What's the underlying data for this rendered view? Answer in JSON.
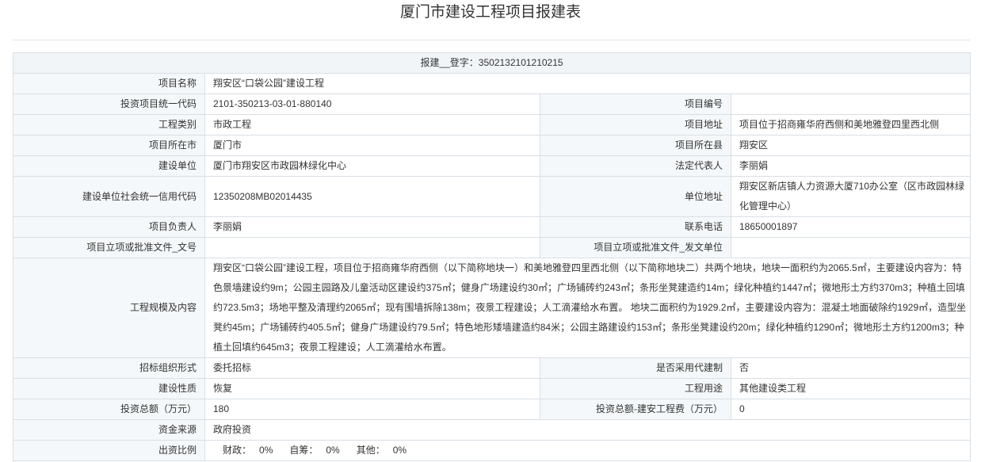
{
  "title": "厦门市建设工程项目报建表",
  "registration": {
    "label": "报建__登字：",
    "number": "3502132101210215"
  },
  "form": {
    "project_name": {
      "label": "项目名称",
      "value": "翔安区“口袋公园”建设工程"
    },
    "investment_code": {
      "label": "投资项目统一代码",
      "value": "2101-350213-03-01-880140"
    },
    "project_number": {
      "label": "项目编号"
    },
    "project_category": {
      "label": "工程类别",
      "value": "市政工程"
    },
    "project_address": {
      "label": "项目地址",
      "value": "项目位于招商雍华府西侧和美地雅登四里西北侧"
    },
    "project_city": {
      "label": "项目所在市",
      "value": "厦门市"
    },
    "project_county": {
      "label": "项目所在县",
      "value": "翔安区"
    },
    "construction_unit": {
      "label": "建设单位",
      "value": "厦门市翔安区市政园林绿化中心"
    },
    "legal_representative": {
      "label": "法定代表人",
      "value": "李丽娟"
    },
    "credit_code": {
      "label": "建设单位社会统一信用代码",
      "value": "12350208MB02014435"
    },
    "unit_address": {
      "label": "单位地址",
      "value": "翔安区新店镇人力资源大厦710办公室（区市政园林绿化管理中心）"
    },
    "project_leader": {
      "label": "项目负责人",
      "value": "李丽娟"
    },
    "contact_phone": {
      "label": "联系电话",
      "value": "18650001897"
    },
    "approval_doc_number": {
      "label": "项目立项或批准文件_文号"
    },
    "approval_issuing_unit": {
      "label": "项目立项或批准文件_发文单位"
    },
    "scale_and_content": {
      "label": "工程规模及内容",
      "value": "翔安区“口袋公园”建设工程，项目位于招商雍华府西侧（以下简称地块一）和美地雅登四里西北侧（以下简称地块二）共两个地块，地块一面积约为2065.5㎡，主要建设内容为：特色景墙建设约9m；公园主园路及儿童活动区建设约375㎡；健身广场建设约30㎡；广场铺砖约243㎡；条形坐凳建造约14m；绿化种植约1447㎡；微地形土方约370m3；种植土回填约723.5m3；场地平整及清理约2065㎡；现有围墙拆除138m；夜景工程建设；人工滴灌给水布置。 地块二面积约为1929.2㎡，主要建设内容为：混凝土地面破除约1929㎡，造型坐凳约45m；广场铺砖约405.5㎡；健身广场建设约79.5㎡；特色地形矮墙建造约84米；公园主路建设约153㎡；条形坐凳建设约20m；绿化种植约1290㎡；微地形土方约1200m3；种植土回填约645m3；夜景工程建设；人工滴灌给水布置。"
    },
    "tender_form": {
      "label": "招标组织形式",
      "value": "委托招标"
    },
    "agent_construction": {
      "label": "是否采用代建制",
      "value": "否"
    },
    "construction_nature": {
      "label": "建设性质",
      "value": "恢复"
    },
    "project_use": {
      "label": "工程用途",
      "value": "其他建设类工程"
    },
    "total_investment": {
      "label": "投资总额（万元）",
      "value": "180"
    },
    "installation_cost": {
      "label": "投资总额-建安工程费（万元）",
      "value": "0"
    },
    "fund_source": {
      "label": "资金来源",
      "value": "政府投资"
    },
    "funding_ratio": {
      "label": "出资比例",
      "items": [
        {
          "label": "财政：",
          "value": "0%"
        },
        {
          "label": "自筹：",
          "value": "0%"
        },
        {
          "label": "其他：",
          "value": "0%"
        }
      ]
    }
  },
  "colors": {
    "label_background": "#f5f8fa",
    "header_background": "#f2f5f8",
    "border": "#d9dfe5",
    "text": "#333333"
  }
}
